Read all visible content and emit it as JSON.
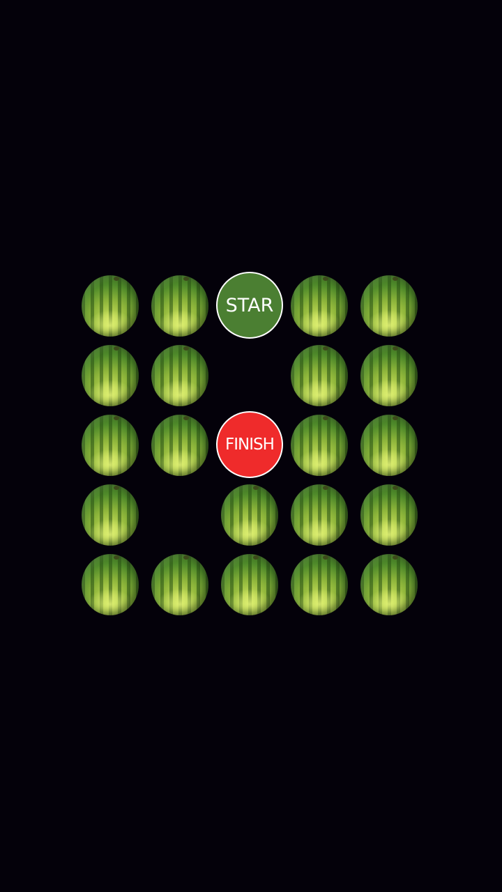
{
  "game": {
    "start_label": "STAR",
    "finish_label": "FINISH",
    "start_color": "#4b7f32",
    "finish_color": "#ef2b2b",
    "board": {
      "rows": 5,
      "cols": 5,
      "cells": [
        [
          "melon",
          "melon",
          "start",
          "melon",
          "melon"
        ],
        [
          "melon",
          "melon",
          "empty",
          "melon",
          "melon"
        ],
        [
          "melon",
          "melon",
          "finish",
          "melon",
          "melon"
        ],
        [
          "melon",
          "empty",
          "melon",
          "melon",
          "melon"
        ],
        [
          "melon",
          "melon",
          "melon",
          "melon",
          "melon"
        ]
      ]
    },
    "piece_icon": "watermelon-icon"
  }
}
